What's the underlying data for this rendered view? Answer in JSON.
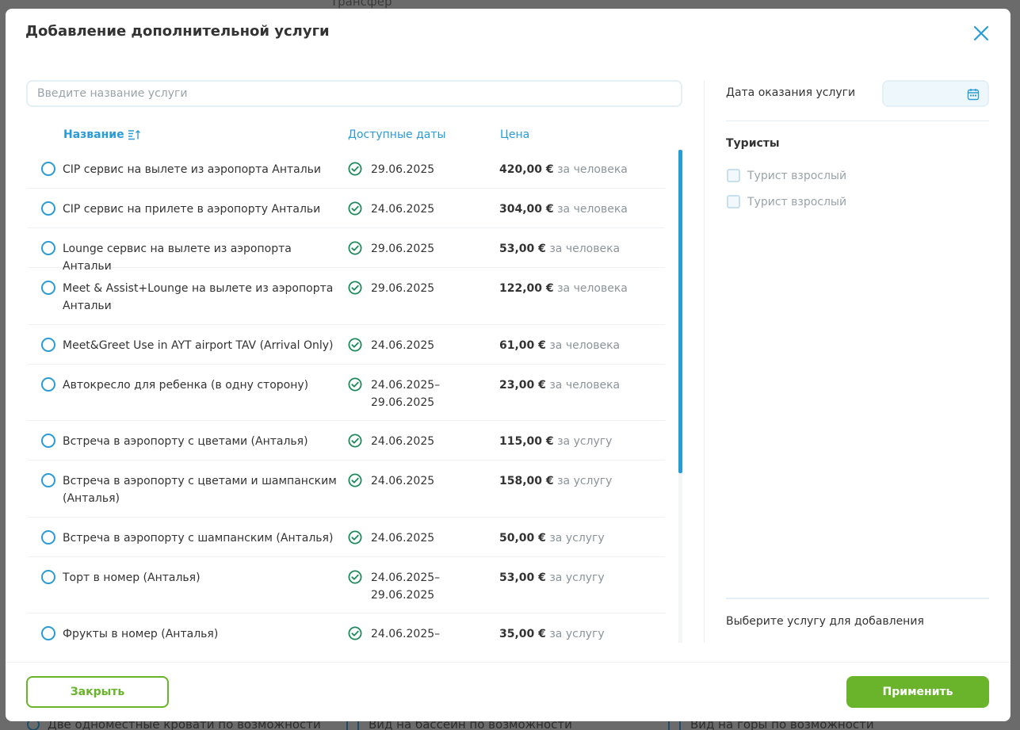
{
  "background": {
    "top_text": "Трансфер",
    "bottom_items": [
      "Две одноместные кровати по возможности",
      "Вид на бассейн по возможности",
      "Вид на горы по возможности"
    ]
  },
  "modal": {
    "title": "Добавление дополнительной услуги",
    "close_icon": "close-icon"
  },
  "search": {
    "placeholder": "Введите название услуги",
    "value": ""
  },
  "table": {
    "headers": {
      "name": "Название",
      "dates": "Доступные даты",
      "price": "Цена"
    },
    "rows": [
      {
        "name": "CIP сервис на вылете из аэропорта Антальи",
        "dates": "29.06.2025",
        "price": "420,00 €",
        "unit": "за человека"
      },
      {
        "name": "CIP сервис на прилете в аэропорту Антальи",
        "dates": "24.06.2025",
        "price": "304,00 €",
        "unit": "за человека"
      },
      {
        "name": "Lounge сервис на вылете из аэропорта Антальи",
        "dates": "29.06.2025",
        "price": "53,00 €",
        "unit": "за человека"
      },
      {
        "name": "Meet & Assist+Lounge на вылете из аэропорта Антальи",
        "dates": "29.06.2025",
        "price": "122,00 €",
        "unit": "за человека"
      },
      {
        "name": "Meet&Greet Use in AYT airport TAV (Arrival Only)",
        "dates": "24.06.2025",
        "price": "61,00 €",
        "unit": "за человека"
      },
      {
        "name": "Автокресло для ребенка (в одну сторону)",
        "dates": "24.06.2025–29.06.2025",
        "price": "23,00 €",
        "unit": "за человека"
      },
      {
        "name": "Встреча в аэропорту с цветами (Анталья)",
        "dates": "24.06.2025",
        "price": "115,00 €",
        "unit": "за услугу"
      },
      {
        "name": "Встреча в аэропорту с цветами и шампанским (Анталья)",
        "dates": "24.06.2025",
        "price": "158,00 €",
        "unit": "за услугу"
      },
      {
        "name": "Встреча в аэропорту с шампанским (Анталья)",
        "dates": "24.06.2025",
        "price": "50,00 €",
        "unit": "за услугу"
      },
      {
        "name": "Торт в номер (Анталья)",
        "dates": "24.06.2025–29.06.2025",
        "price": "53,00 €",
        "unit": "за услугу"
      },
      {
        "name": "Фрукты в номер (Анталья)",
        "dates": "24.06.2025–",
        "price": "35,00 €",
        "unit": "за услугу"
      }
    ]
  },
  "right_panel": {
    "date_label": "Дата оказания услуги",
    "date_value": "",
    "tourists_title": "Туристы",
    "tourists": [
      "Турист взрослый",
      "Турист взрослый"
    ],
    "hint": "Выберите услугу для добавления"
  },
  "footer": {
    "close_label": "Закрыть",
    "apply_label": "Применить"
  },
  "colors": {
    "accent": "#2a9bd7",
    "green": "#6ab42c",
    "check": "#1f8a5b"
  }
}
